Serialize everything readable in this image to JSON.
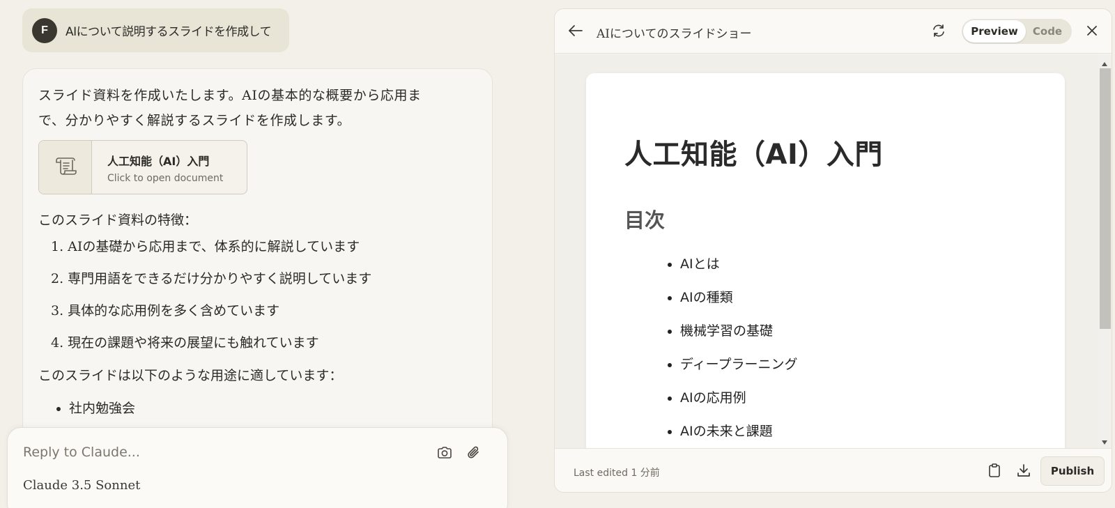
{
  "user_message": {
    "avatar_initial": "F",
    "text": "AIについて説明するスライドを作成して"
  },
  "assistant": {
    "intro": "スライド資料を作成いたします。AIの基本的な概要から応用まで、分かりやすく解説するスライドを作成します。",
    "document_card": {
      "icon": "scroll-document-icon",
      "title": "人工知能（AI）入門",
      "subtitle": "Click to open document"
    },
    "features_heading": "このスライド資料の特徴：",
    "features": [
      "1. AIの基礎から応用まで、体系的に解説しています",
      "2. 専門用語をできるだけ分かりやすく説明しています",
      "3. 具体的な応用例を多く含めています",
      "4. 現在の課題や将来の展望にも触れています"
    ],
    "uses_heading": "このスライドは以下のような用途に適しています：",
    "uses": [
      "社内勉強会"
    ]
  },
  "composer": {
    "placeholder": "Reply to Claude...",
    "model": "Claude 3.5 Sonnet",
    "icons": [
      "camera-icon",
      "paperclip-icon"
    ]
  },
  "panel": {
    "title": "AIについてのスライドショー",
    "toggle": {
      "preview": "Preview",
      "code": "Code",
      "active": "preview"
    },
    "slide": {
      "title": "人工知能（AI）入門",
      "subtitle": "目次",
      "toc": [
        "AIとは",
        "AIの種類",
        "機械学習の基礎",
        "ディープラーニング",
        "AIの応用例",
        "AIの未来と課題"
      ]
    },
    "footer": {
      "last_edited": "Last edited 1 分前",
      "publish": "Publish"
    }
  },
  "colors": {
    "background": "#f2f0e9",
    "user_bubble": "#e8e4d6",
    "avatar": "#3a3630",
    "scroll_thumb": "#c2c1bc"
  }
}
